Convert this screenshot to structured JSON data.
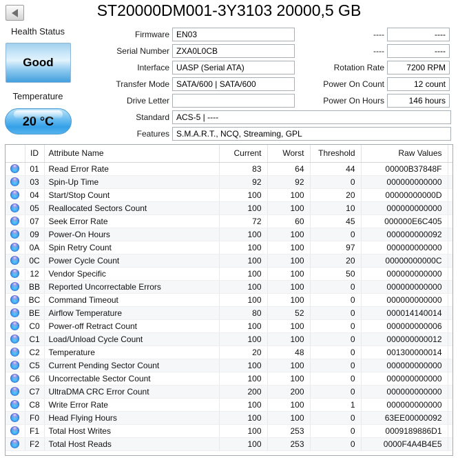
{
  "window": {
    "title": "ST20000DM001-3Y3103 20000,5 GB"
  },
  "header": {
    "back_button_icon": "left-arrow"
  },
  "health": {
    "label": "Health Status",
    "status": "Good"
  },
  "temperature": {
    "label": "Temperature",
    "value": "20 °C"
  },
  "info_fields": {
    "left": [
      {
        "label": "Firmware",
        "value": "EN03"
      },
      {
        "label": "Serial Number",
        "value": "ZXA0L0CB"
      },
      {
        "label": "Interface",
        "value": "UASP (Serial ATA)"
      },
      {
        "label": "Transfer Mode",
        "value": "SATA/600 | SATA/600"
      },
      {
        "label": "Drive Letter",
        "value": ""
      }
    ],
    "wide": [
      {
        "label": "Standard",
        "value": "ACS-5 | ----"
      },
      {
        "label": "Features",
        "value": "S.M.A.R.T., NCQ, Streaming, GPL"
      }
    ],
    "right": [
      {
        "label": "----",
        "value": "----"
      },
      {
        "label": "----",
        "value": "----"
      },
      {
        "label": "Rotation Rate",
        "value": "7200 RPM"
      },
      {
        "label": "Power On Count",
        "value": "12 count"
      },
      {
        "label": "Power On Hours",
        "value": "146 hours"
      }
    ]
  },
  "smart_table": {
    "columns": [
      "ID",
      "Attribute Name",
      "Current",
      "Worst",
      "Threshold",
      "Raw Values"
    ],
    "rows": [
      {
        "id": "01",
        "name": "Read Error Rate",
        "current": 83,
        "worst": 64,
        "threshold": 44,
        "raw": "00000B37848F"
      },
      {
        "id": "03",
        "name": "Spin-Up Time",
        "current": 92,
        "worst": 92,
        "threshold": 0,
        "raw": "000000000000"
      },
      {
        "id": "04",
        "name": "Start/Stop Count",
        "current": 100,
        "worst": 100,
        "threshold": 20,
        "raw": "00000000000D"
      },
      {
        "id": "05",
        "name": "Reallocated Sectors Count",
        "current": 100,
        "worst": 100,
        "threshold": 10,
        "raw": "000000000000"
      },
      {
        "id": "07",
        "name": "Seek Error Rate",
        "current": 72,
        "worst": 60,
        "threshold": 45,
        "raw": "000000E6C405"
      },
      {
        "id": "09",
        "name": "Power-On Hours",
        "current": 100,
        "worst": 100,
        "threshold": 0,
        "raw": "000000000092"
      },
      {
        "id": "0A",
        "name": "Spin Retry Count",
        "current": 100,
        "worst": 100,
        "threshold": 97,
        "raw": "000000000000"
      },
      {
        "id": "0C",
        "name": "Power Cycle Count",
        "current": 100,
        "worst": 100,
        "threshold": 20,
        "raw": "00000000000C"
      },
      {
        "id": "12",
        "name": "Vendor Specific",
        "current": 100,
        "worst": 100,
        "threshold": 50,
        "raw": "000000000000"
      },
      {
        "id": "BB",
        "name": "Reported Uncorrectable Errors",
        "current": 100,
        "worst": 100,
        "threshold": 0,
        "raw": "000000000000"
      },
      {
        "id": "BC",
        "name": "Command Timeout",
        "current": 100,
        "worst": 100,
        "threshold": 0,
        "raw": "000000000000"
      },
      {
        "id": "BE",
        "name": "Airflow Temperature",
        "current": 80,
        "worst": 52,
        "threshold": 0,
        "raw": "000014140014"
      },
      {
        "id": "C0",
        "name": "Power-off Retract Count",
        "current": 100,
        "worst": 100,
        "threshold": 0,
        "raw": "000000000006"
      },
      {
        "id": "C1",
        "name": "Load/Unload Cycle Count",
        "current": 100,
        "worst": 100,
        "threshold": 0,
        "raw": "000000000012"
      },
      {
        "id": "C2",
        "name": "Temperature",
        "current": 20,
        "worst": 48,
        "threshold": 0,
        "raw": "001300000014"
      },
      {
        "id": "C5",
        "name": "Current Pending Sector Count",
        "current": 100,
        "worst": 100,
        "threshold": 0,
        "raw": "000000000000"
      },
      {
        "id": "C6",
        "name": "Uncorrectable Sector Count",
        "current": 100,
        "worst": 100,
        "threshold": 0,
        "raw": "000000000000"
      },
      {
        "id": "C7",
        "name": "UltraDMA CRC Error Count",
        "current": 200,
        "worst": 200,
        "threshold": 0,
        "raw": "000000000000"
      },
      {
        "id": "C8",
        "name": "Write Error Rate",
        "current": 100,
        "worst": 100,
        "threshold": 1,
        "raw": "000000000000"
      },
      {
        "id": "F0",
        "name": "Head Flying Hours",
        "current": 100,
        "worst": 100,
        "threshold": 0,
        "raw": "63EE00000092"
      },
      {
        "id": "F1",
        "name": "Total Host Writes",
        "current": 100,
        "worst": 253,
        "threshold": 0,
        "raw": "0009189886D1"
      },
      {
        "id": "F2",
        "name": "Total Host Reads",
        "current": 100,
        "worst": 253,
        "threshold": 0,
        "raw": "0000F4A4B4E5"
      }
    ]
  },
  "colors": {
    "health_good_top": "#cde9f9",
    "health_good_bottom": "#43a0de",
    "temperature_pill": "#35a0e8",
    "status_orb": "#3fa8ee",
    "field_border": "#a9aeb5",
    "table_border": "#a6abb1"
  }
}
